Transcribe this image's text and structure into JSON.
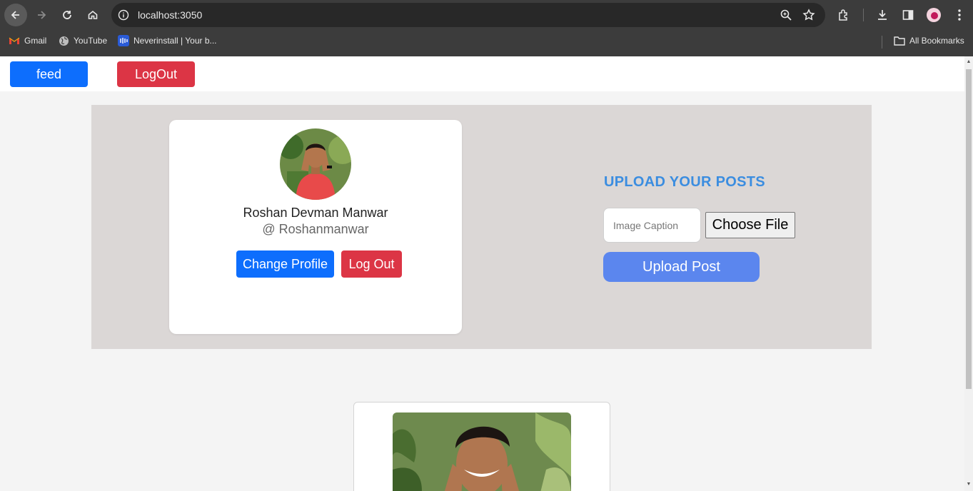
{
  "browser": {
    "url": "localhost:3050",
    "bookmarks": [
      {
        "label": "Gmail",
        "icon": "gmail-icon"
      },
      {
        "label": "YouTube",
        "icon": "globe-icon"
      },
      {
        "label": "Neverinstall | Your b...",
        "icon": "neverinstall-icon"
      }
    ],
    "all_bookmarks_label": "All Bookmarks"
  },
  "topbar": {
    "feed_label": "feed",
    "logout_label": "LogOut"
  },
  "profile": {
    "name": "Roshan Devman Manwar",
    "handle": "@ Roshanmanwar",
    "change_profile_label": "Change Profile",
    "logout_label": "Log Out"
  },
  "upload": {
    "title": "UPLOAD YOUR POSTS",
    "caption_placeholder": "Image Caption",
    "choose_file_label": "Choose File",
    "upload_label": "Upload Post"
  },
  "colors": {
    "primary": "#0d6efd",
    "danger": "#dc3545",
    "upload_button": "#5b86ee",
    "title_accent": "#3b8de0",
    "panel_bg": "#dbd7d6"
  }
}
